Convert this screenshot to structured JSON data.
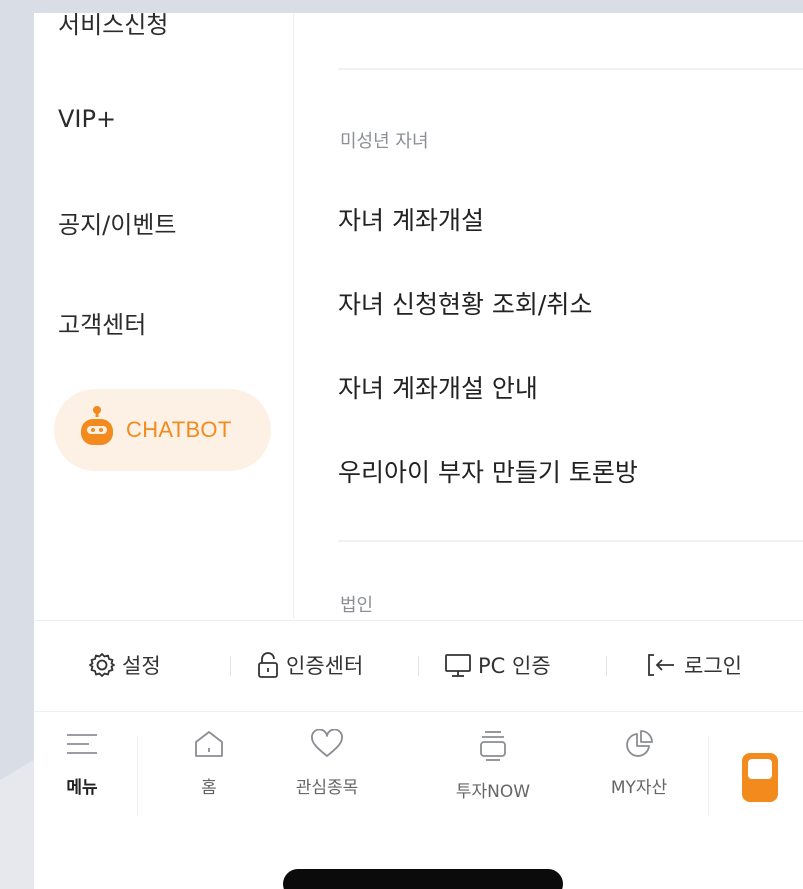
{
  "left_menu": {
    "top_cut": "서비스신청",
    "items": [
      "VIP+",
      "공지/이벤트",
      "고객센터"
    ],
    "chatbot_label": "CHATBOT",
    "chatbot_icon": "robot-icon"
  },
  "right_menu": {
    "section1_label": "미성년 자녀",
    "section1_items": [
      "자녀 계좌개설",
      "자녀 신청현황 조회/취소",
      "자녀 계좌개설 안내",
      "우리아이 부자 만들기 토론방"
    ],
    "section2_label": "법인"
  },
  "utility_bar": {
    "settings": "설정",
    "auth_center": "인증센터",
    "pc_auth": "PC 인증",
    "login": "로그인"
  },
  "tab_bar": {
    "tabs": [
      "메뉴",
      "홈",
      "관심종목",
      "투자NOW",
      "MY자산"
    ],
    "active": "메뉴"
  },
  "colors": {
    "accent": "#f38a1d",
    "chatbot_bg": "#fdf1e6",
    "background": "#d9dde6"
  }
}
